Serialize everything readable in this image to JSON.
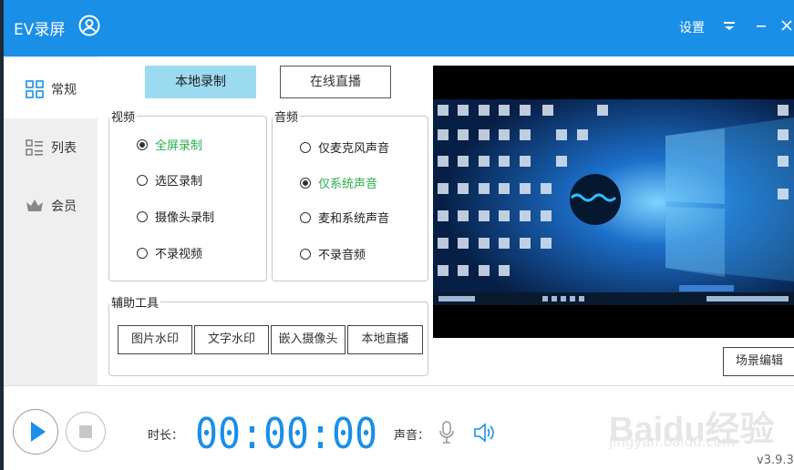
{
  "app": {
    "title": "EV录屏"
  },
  "titlebar": {
    "settings_label": "设置"
  },
  "sidebar": {
    "items": [
      {
        "label": "常规",
        "icon": "grid-icon",
        "active": true
      },
      {
        "label": "列表",
        "icon": "list-icon",
        "active": false
      },
      {
        "label": "会员",
        "icon": "crown-icon",
        "active": false
      }
    ]
  },
  "mode_tabs": {
    "local": "本地录制",
    "live": "在线直播"
  },
  "video": {
    "title": "视频",
    "options": [
      "全屏录制",
      "选区录制",
      "摄像头录制",
      "不录视频"
    ],
    "selected": "全屏录制"
  },
  "audio": {
    "title": "音频",
    "options": [
      "仅麦克风声音",
      "仅系统声音",
      "麦和系统声音",
      "不录音频"
    ],
    "selected": "仅系统声音"
  },
  "tools": {
    "title": "辅助工具",
    "buttons": [
      "图片水印",
      "文字水印",
      "嵌入摄像头",
      "本地直播"
    ]
  },
  "preview": {
    "scene_edit_label": "场景编辑"
  },
  "bottom": {
    "duration_label": "时长：",
    "timer": "00:00:00",
    "sound_label": "声音：",
    "version": "v3.9.3"
  },
  "watermark": {
    "brand": "Baidu经验",
    "url": "jingyan.baidu.com"
  },
  "colors": {
    "accent": "#1a8fe8",
    "checked_green": "#29b04a",
    "tab_active": "#9bdaef"
  }
}
